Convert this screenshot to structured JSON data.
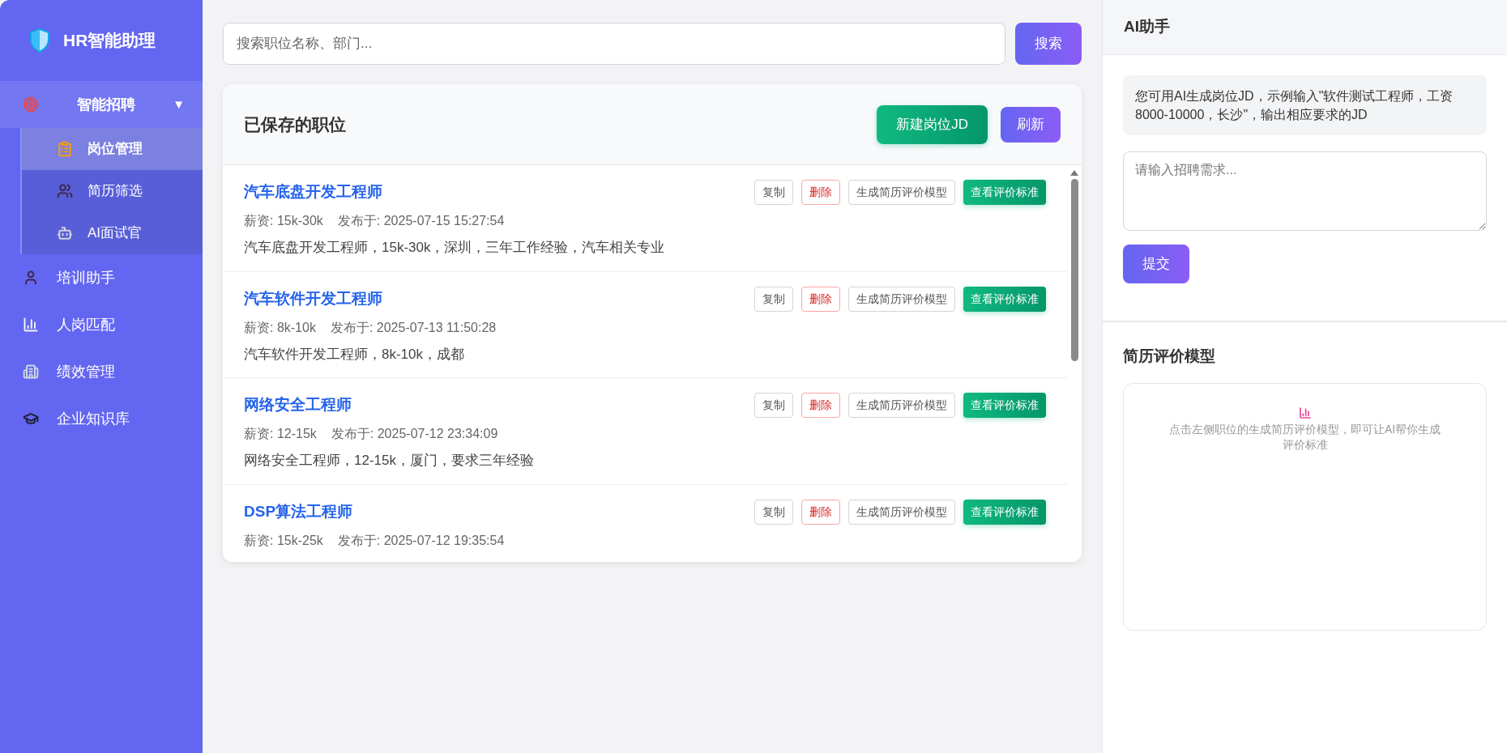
{
  "sidebar": {
    "title": "HR智能助理",
    "items": [
      {
        "label": "智能招聘",
        "selected": false,
        "expanded": true,
        "toggle": "▼",
        "children": [
          {
            "label": "岗位管理",
            "selected": true
          },
          {
            "label": "简历筛选",
            "selected": false
          },
          {
            "label": "AI面试官",
            "selected": false
          }
        ]
      },
      {
        "label": "培训助手",
        "selected": false
      },
      {
        "label": "人岗匹配",
        "selected": false
      },
      {
        "label": "绩效管理",
        "selected": false
      },
      {
        "label": "企业知识库",
        "selected": false
      }
    ]
  },
  "search": {
    "placeholder": "搜索职位名称、部门...",
    "button": "搜索"
  },
  "jobs_panel": {
    "title": "已保存的职位",
    "buttons": [
      {
        "label": "新建岗位JD",
        "kind": "success"
      },
      {
        "label": "刷新",
        "kind": "primary"
      }
    ],
    "jobs": [
      {
        "title": "汽车底盘开发工程师",
        "salary": "薪资: 15k-30k",
        "published": "发布于: 2025-07-15 15:27:54",
        "description": "汽车底盘开发工程师，15k-30k，深圳，三年工作经验，汽车相关专业",
        "actions": [
          {
            "label": "复制",
            "kind": "default"
          },
          {
            "label": "删除",
            "kind": "danger"
          },
          {
            "label": "生成简历评价模型",
            "kind": "default"
          },
          {
            "label": "查看评价标准",
            "kind": "success"
          }
        ]
      },
      {
        "title": "汽车软件开发工程师",
        "salary": "薪资: 8k-10k",
        "published": "发布于: 2025-07-13 11:50:28",
        "description": "汽车软件开发工程师，8k-10k，成都",
        "actions": [
          {
            "label": "复制",
            "kind": "default"
          },
          {
            "label": "删除",
            "kind": "danger"
          },
          {
            "label": "生成简历评价模型",
            "kind": "default"
          },
          {
            "label": "查看评价标准",
            "kind": "success"
          }
        ]
      },
      {
        "title": "网络安全工程师",
        "salary": "薪资: 12-15k",
        "published": "发布于: 2025-07-12 23:34:09",
        "description": "网络安全工程师，12-15k，厦门，要求三年经验",
        "actions": [
          {
            "label": "复制",
            "kind": "default"
          },
          {
            "label": "删除",
            "kind": "danger"
          },
          {
            "label": "生成简历评价模型",
            "kind": "default"
          },
          {
            "label": "查看评价标准",
            "kind": "success"
          }
        ]
      },
      {
        "title": "DSP算法工程师",
        "salary": "薪资: 15k-25k",
        "published": "发布于: 2025-07-12 19:35:54",
        "actions": [
          {
            "label": "复制",
            "kind": "default"
          },
          {
            "label": "删除",
            "kind": "danger"
          },
          {
            "label": "生成简历评价模型",
            "kind": "default"
          },
          {
            "label": "查看评价标准",
            "kind": "success"
          }
        ]
      }
    ]
  },
  "assistant": {
    "title": "AI助手",
    "hint": "您可用AI生成岗位JD，示例输入\"软件测试工程师，工资8000-10000，长沙\"，输出相应要求的JD",
    "placeholder": "请输入招聘需求...",
    "submit": "提交"
  },
  "resume_model": {
    "title": "简历评价模型",
    "empty_text": "点击左侧职位的生成简历评价模型，即可让AI帮你生成评价标准"
  }
}
